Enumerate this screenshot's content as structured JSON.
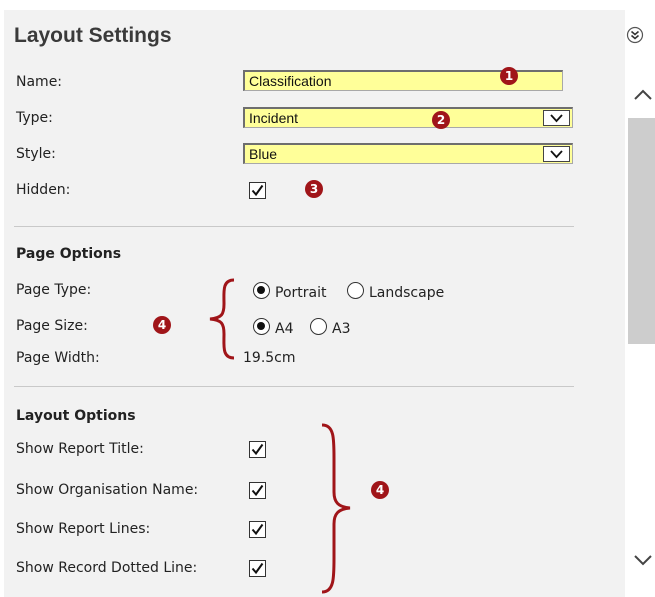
{
  "panel": {
    "title": "Layout Settings"
  },
  "fields": {
    "name": {
      "label": "Name:",
      "value": "Classification"
    },
    "type": {
      "label": "Type:",
      "value": "Incident"
    },
    "style": {
      "label": "Style:",
      "value": "Blue"
    },
    "hidden": {
      "label": "Hidden:",
      "checked": true
    }
  },
  "page_options": {
    "heading": "Page Options",
    "page_type": {
      "label": "Page Type:",
      "options": [
        "Portrait",
        "Landscape"
      ],
      "selected": "Portrait"
    },
    "page_size": {
      "label": "Page Size:",
      "options": [
        "A4",
        "A3"
      ],
      "selected": "A4"
    },
    "page_width": {
      "label": "Page Width:",
      "value": "19.5cm"
    }
  },
  "layout_options": {
    "heading": "Layout Options",
    "items": [
      {
        "label": "Show Report Title:",
        "checked": true
      },
      {
        "label": "Show Organisation Name:",
        "checked": true
      },
      {
        "label": "Show Report Lines:",
        "checked": true
      },
      {
        "label": "Show Record Dotted Line:",
        "checked": true
      }
    ]
  },
  "annotations": {
    "b1": "1",
    "b2": "2",
    "b3": "3",
    "b4a": "4",
    "b4b": "4"
  },
  "icons": {
    "collapse": "double-chevron-down-icon",
    "scroll_up": "chevron-up-icon",
    "scroll_down": "chevron-down-icon"
  },
  "colors": {
    "field_bg": "#ffff99",
    "badge": "#a01519",
    "panel_bg": "#f2f2f2"
  }
}
